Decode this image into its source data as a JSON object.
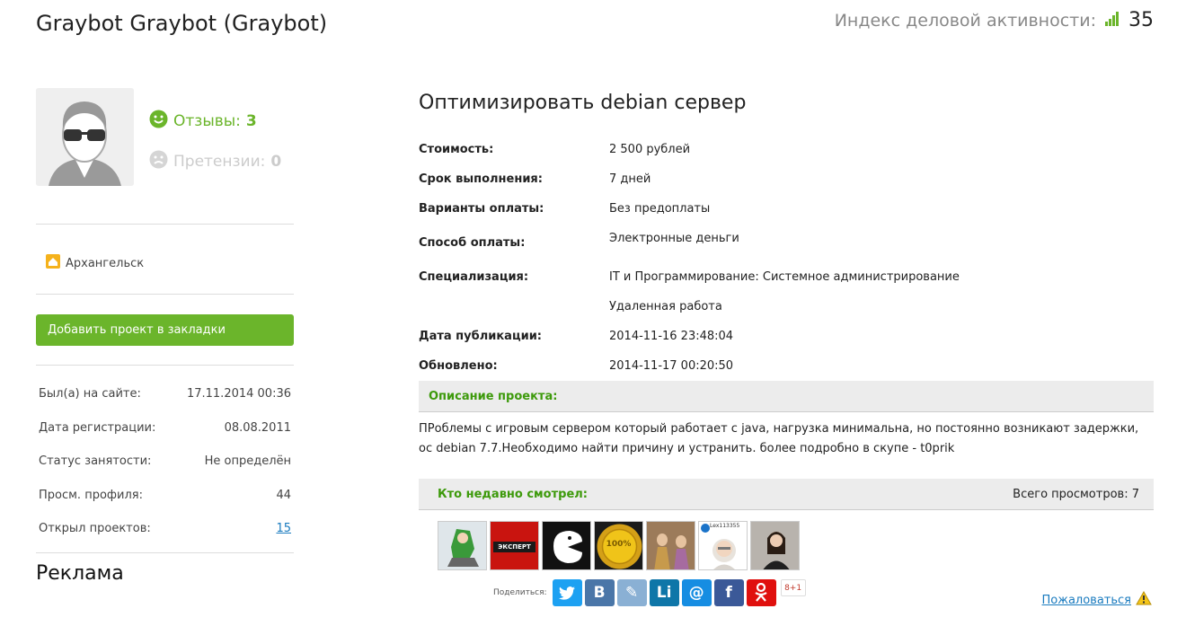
{
  "header": {
    "user_title": "Graybot Graybot (Graybot)",
    "activity_label": "Индекс деловой активности:",
    "activity_value": "35"
  },
  "sidebar": {
    "reviews_label": "Отзывы:",
    "reviews_count": "3",
    "claims_label": "Претензии:",
    "claims_count": "0",
    "city": "Архангельск",
    "bookmark_button": "Добавить проект в закладки",
    "stats": [
      {
        "label": "Был(а) на сайте:",
        "value": "17.11.2014 00:36"
      },
      {
        "label": "Дата регистрации:",
        "value": "08.08.2011"
      },
      {
        "label": "Статус занятости:",
        "value": "Не определён"
      },
      {
        "label": "Просм. профиля:",
        "value": "44"
      },
      {
        "label": "Открыл проектов:",
        "value": "15"
      }
    ],
    "ads_title": "Реклама"
  },
  "project": {
    "title": "Оптимизировать debian сервер",
    "details": [
      {
        "label": "Стоимость:",
        "value": "2 500 рублей"
      },
      {
        "label": "Срок выполнения:",
        "value": "7 дней"
      },
      {
        "label": "Варианты оплаты:",
        "value": "Без предоплаты"
      },
      {
        "label": "Способ оплаты:",
        "value": "Электронные деньги"
      },
      {
        "label": "Специализация:",
        "value": "IT и Программирование: Системное администрирование"
      },
      {
        "label": "",
        "value": "Удаленная работа"
      },
      {
        "label": "Дата публикации:",
        "value": "2014-11-16 23:48:04"
      },
      {
        "label": "Обновлено:",
        "value": "2014-11-17 00:20:50"
      }
    ],
    "description_header": "Описание проекта:",
    "description_line1": "ПРоблемы с игровым сервером который работает с java, нагрузка минимальна, но постоянно возникают задержки,",
    "description_line2": "ос debian 7.7.Необходимо найти причину и устранить. более подробно в скупе - t0prik"
  },
  "viewed": {
    "title": "Кто недавно смотрел:",
    "total": "Всего просмотров: 7",
    "viewer_label_expert": "ЭКСПЕРТ",
    "viewer_label_100": "100%",
    "viewer_label_lex": "Lex113355"
  },
  "share": {
    "label": "Поделиться:",
    "gplus": "8+1",
    "buttons": [
      {
        "name": "twitter",
        "glyph": "🐦",
        "color": "#1da1f2"
      },
      {
        "name": "vkontakte",
        "glyph": "B",
        "color": "#4a76a8"
      },
      {
        "name": "livejournal",
        "glyph": "✎",
        "color": "#8ab0d4"
      },
      {
        "name": "linkedin",
        "glyph": "Li",
        "color": "#0e76a8"
      },
      {
        "name": "mailru",
        "glyph": "@",
        "color": "#168de2"
      },
      {
        "name": "facebook",
        "glyph": "f",
        "color": "#3b5998"
      },
      {
        "name": "odnoklassniki",
        "glyph": "ok",
        "color": "#e0100e"
      }
    ]
  },
  "report": {
    "label": "Пожаловаться"
  }
}
